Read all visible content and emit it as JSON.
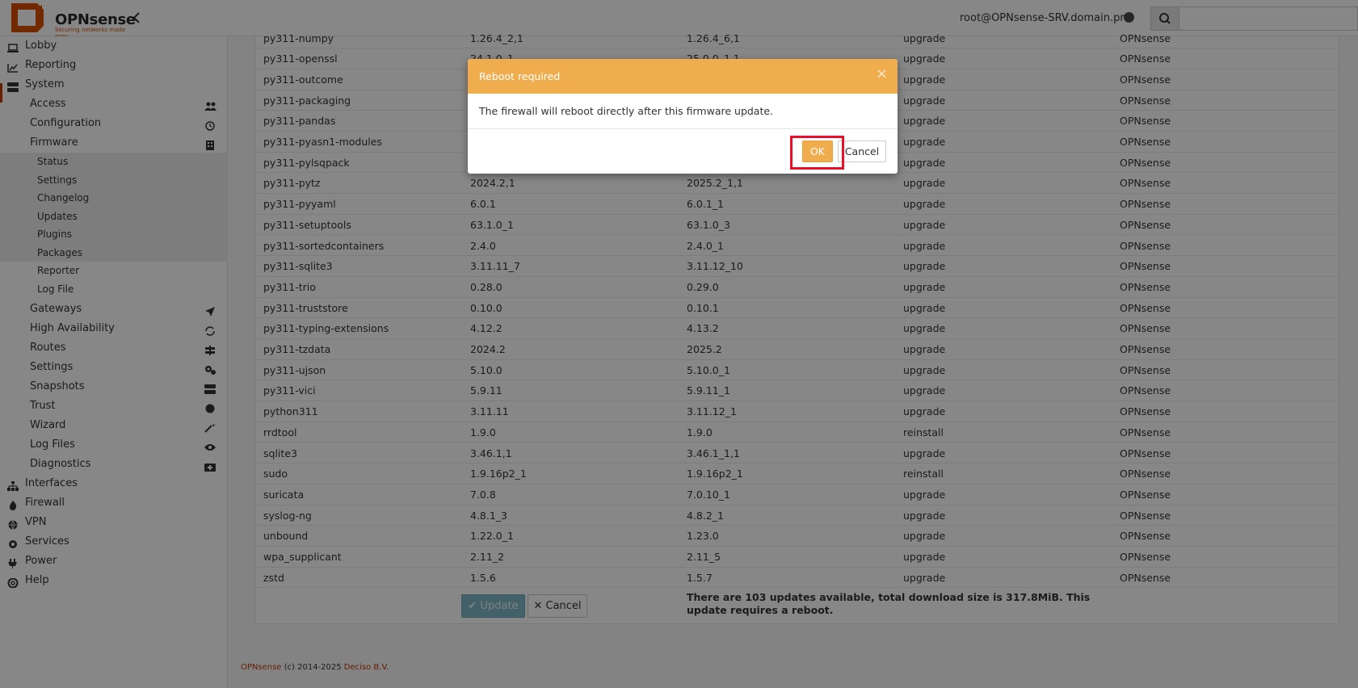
{
  "header": {
    "brand": "OPNsense",
    "tagline": "Securing networks made easy",
    "user": "root@OPNsense-SRV.domain.prv",
    "search_placeholder": ""
  },
  "sidebar": {
    "top_items": [
      {
        "label": "Lobby",
        "icon": "laptop-icon"
      },
      {
        "label": "Reporting",
        "icon": "chart-icon"
      },
      {
        "label": "System",
        "icon": "server-icon"
      }
    ],
    "system_items": [
      {
        "label": "Access",
        "icon": "users-icon"
      },
      {
        "label": "Configuration",
        "icon": "history-icon"
      },
      {
        "label": "Firmware",
        "icon": "building-icon"
      }
    ],
    "firmware_items": [
      "Status",
      "Settings",
      "Changelog",
      "Updates",
      "Plugins",
      "Packages",
      "Reporter",
      "Log File"
    ],
    "system_items_2": [
      {
        "label": "Gateways",
        "icon": "location-arrow-icon"
      },
      {
        "label": "High Availability",
        "icon": "refresh-icon"
      },
      {
        "label": "Routes",
        "icon": "signpost-icon"
      },
      {
        "label": "Settings",
        "icon": "cogs-icon"
      },
      {
        "label": "Snapshots",
        "icon": "hdd-icon"
      },
      {
        "label": "Trust",
        "icon": "certificate-icon"
      },
      {
        "label": "Wizard",
        "icon": "magic-icon"
      },
      {
        "label": "Log Files",
        "icon": "eye-icon"
      },
      {
        "label": "Diagnostics",
        "icon": "medkit-icon"
      }
    ],
    "bottom_items": [
      {
        "label": "Interfaces",
        "icon": "sitemap-icon"
      },
      {
        "label": "Firewall",
        "icon": "fire-icon"
      },
      {
        "label": "VPN",
        "icon": "globe-icon"
      },
      {
        "label": "Services",
        "icon": "cog-icon"
      },
      {
        "label": "Power",
        "icon": "plug-icon"
      },
      {
        "label": "Help",
        "icon": "lifebuoy-icon"
      }
    ]
  },
  "packages": {
    "rows": [
      [
        "py311-numpy",
        "1.26.4_2,1",
        "1.26.4_6,1",
        "upgrade",
        "OPNsense"
      ],
      [
        "py311-openssl",
        "24.1.0_1",
        "25.0.0_1,1",
        "upgrade",
        "OPNsense"
      ],
      [
        "py311-outcome",
        "",
        "",
        "upgrade",
        "OPNsense"
      ],
      [
        "py311-packaging",
        "",
        "",
        "upgrade",
        "OPNsense"
      ],
      [
        "py311-pandas",
        "",
        "",
        "upgrade",
        "OPNsense"
      ],
      [
        "py311-pyasn1-modules",
        "",
        "",
        "upgrade",
        "OPNsense"
      ],
      [
        "py311-pylsqpack",
        "",
        "",
        "upgrade",
        "OPNsense"
      ],
      [
        "py311-pytz",
        "2024.2,1",
        "2025.2_1,1",
        "upgrade",
        "OPNsense"
      ],
      [
        "py311-pyyaml",
        "6.0.1",
        "6.0.1_1",
        "upgrade",
        "OPNsense"
      ],
      [
        "py311-setuptools",
        "63.1.0_1",
        "63.1.0_3",
        "upgrade",
        "OPNsense"
      ],
      [
        "py311-sortedcontainers",
        "2.4.0",
        "2.4.0_1",
        "upgrade",
        "OPNsense"
      ],
      [
        "py311-sqlite3",
        "3.11.11_7",
        "3.11.12_10",
        "upgrade",
        "OPNsense"
      ],
      [
        "py311-trio",
        "0.28.0",
        "0.29.0",
        "upgrade",
        "OPNsense"
      ],
      [
        "py311-truststore",
        "0.10.0",
        "0.10.1",
        "upgrade",
        "OPNsense"
      ],
      [
        "py311-typing-extensions",
        "4.12.2",
        "4.13.2",
        "upgrade",
        "OPNsense"
      ],
      [
        "py311-tzdata",
        "2024.2",
        "2025.2",
        "upgrade",
        "OPNsense"
      ],
      [
        "py311-ujson",
        "5.10.0",
        "5.10.0_1",
        "upgrade",
        "OPNsense"
      ],
      [
        "py311-vici",
        "5.9.11",
        "5.9.11_1",
        "upgrade",
        "OPNsense"
      ],
      [
        "python311",
        "3.11.11",
        "3.11.12_1",
        "upgrade",
        "OPNsense"
      ],
      [
        "rrdtool",
        "1.9.0",
        "1.9.0",
        "reinstall",
        "OPNsense"
      ],
      [
        "sqlite3",
        "3.46.1,1",
        "3.46.1_1,1",
        "upgrade",
        "OPNsense"
      ],
      [
        "sudo",
        "1.9.16p2_1",
        "1.9.16p2_1",
        "reinstall",
        "OPNsense"
      ],
      [
        "suricata",
        "7.0.8",
        "7.0.10_1",
        "upgrade",
        "OPNsense"
      ],
      [
        "syslog-ng",
        "4.8.1_3",
        "4.8.2_1",
        "upgrade",
        "OPNsense"
      ],
      [
        "unbound",
        "1.22.0_1",
        "1.23.0",
        "upgrade",
        "OPNsense"
      ],
      [
        "wpa_supplicant",
        "2.11_2",
        "2.11_5",
        "upgrade",
        "OPNsense"
      ],
      [
        "zstd",
        "1.5.6",
        "1.5.7",
        "upgrade",
        "OPNsense"
      ]
    ],
    "update_label": "Update",
    "cancel_label": "Cancel",
    "summary": "There are 103 updates available, total download size is 317.8MiB. This update requires a reboot."
  },
  "footer": {
    "brand": "OPNsense",
    "text": " (c) 2014-2025 ",
    "company": "Deciso B.V."
  },
  "modal": {
    "title": "Reboot required",
    "close": "×",
    "body": "The firewall will reboot directly after this firmware update.",
    "ok_label": "OK",
    "cancel_label": "Cancel"
  },
  "colors": {
    "brand_orange": "#d94f00",
    "modal_header": "#f0ad4e",
    "highlight": "#e8102a"
  }
}
